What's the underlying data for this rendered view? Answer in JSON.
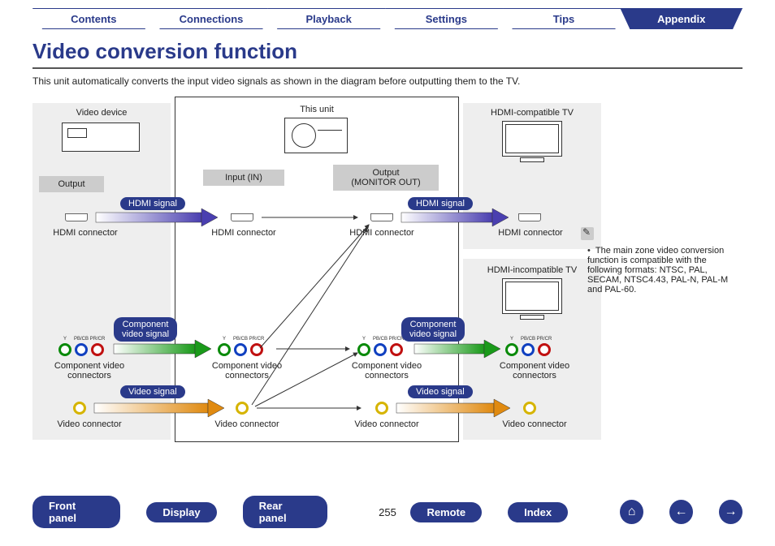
{
  "tabs": [
    "Contents",
    "Connections",
    "Playback",
    "Settings",
    "Tips",
    "Appendix"
  ],
  "active_tab_index": 5,
  "title": "Video conversion function",
  "intro": "This unit automatically converts the input video signals as shown in the diagram before outputting them to the TV.",
  "diagram": {
    "left_zone_title": "Video device",
    "mid_zone_title": "This unit",
    "right1_title": "HDMI-compatible TV",
    "right2_title": "HDMI-incompatible TV",
    "output_label": "Output",
    "input_label": "Input (IN)",
    "monitor_out_label_l1": "Output",
    "monitor_out_label_l2": "(MONITOR OUT)",
    "hdmi_connector": "HDMI connector",
    "component_connectors": "Component video connectors",
    "video_connector": "Video connector",
    "signals": {
      "hdmi": "HDMI signal",
      "component_l1": "Component",
      "component_l2": "video signal",
      "video": "Video signal"
    },
    "component_labels": [
      "Y",
      "PB/CB",
      "PR/CR"
    ],
    "component_colors": [
      "#0a8a0a",
      "#1040c0",
      "#c01010"
    ]
  },
  "note": {
    "bullet": "The main zone video conversion function is compatible with the following formats: NTSC, PAL, SECAM, NTSC4.43, PAL-N, PAL-M and PAL-60."
  },
  "page_number": "255",
  "bottom_buttons": [
    "Front panel",
    "Display",
    "Rear panel",
    "Remote",
    "Index"
  ],
  "nav_icons": {
    "home": "⌂",
    "prev": "←",
    "next": "→"
  }
}
